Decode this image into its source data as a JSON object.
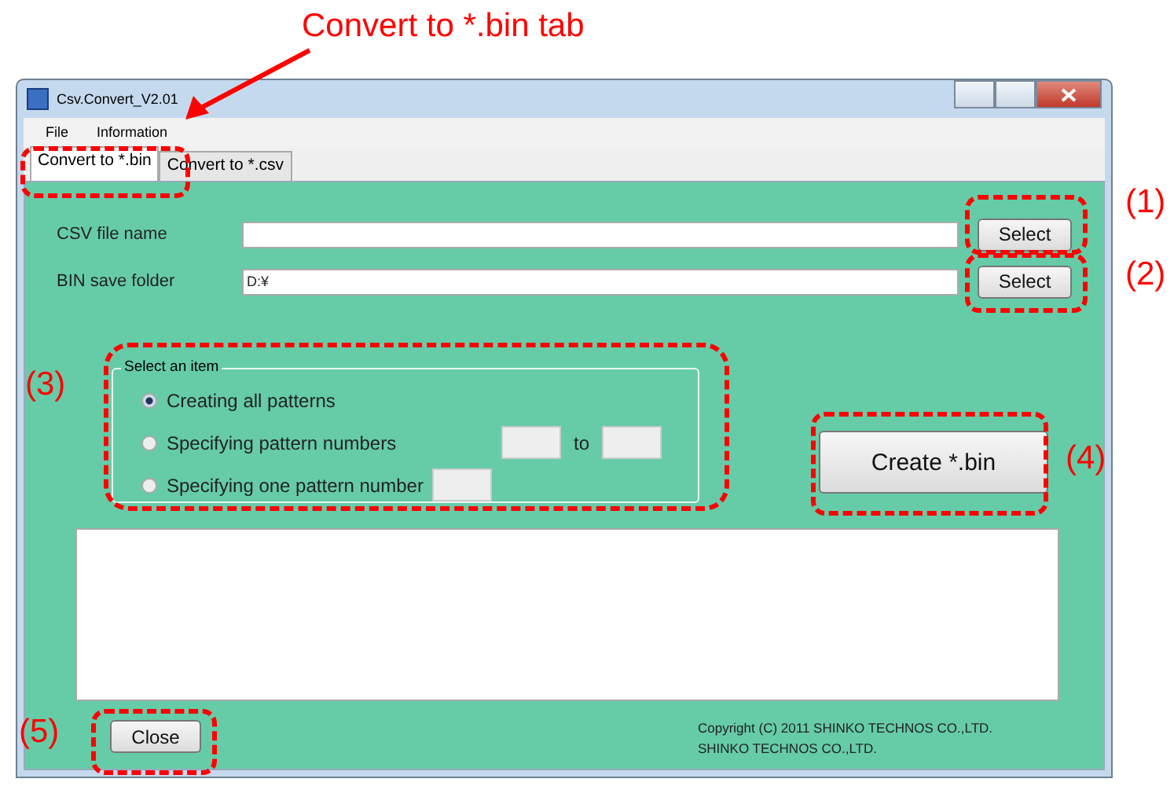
{
  "annotations": {
    "title": "Convert to *.bin tab",
    "markers": [
      {
        "text": "(1)",
        "kind": "select1"
      },
      {
        "text": "(2)",
        "kind": "select2"
      },
      {
        "text": "(3)",
        "kind": "group"
      },
      {
        "text": "(4)",
        "kind": "create"
      },
      {
        "text": "(5)",
        "kind": "close"
      }
    ]
  },
  "window": {
    "title": "Csv.Convert_V2.01"
  },
  "menu": [
    "File",
    "Information"
  ],
  "tabs": [
    {
      "label": "Convert to *.bin",
      "selected": true
    },
    {
      "label": "Convert to *.csv",
      "selected": false
    }
  ],
  "fields": [
    {
      "label": "CSV file name",
      "button": "Select"
    },
    {
      "label": "BIN save folder",
      "value": "D:¥",
      "button": "Select"
    }
  ],
  "group": {
    "title": "Select an item",
    "options": [
      {
        "label": "Creating all patterns",
        "selected": true,
        "kind": "plain"
      },
      {
        "label": "Specifying pattern numbers",
        "selected": false,
        "kind": "range",
        "separator": "to"
      },
      {
        "label": "Specifying one pattern number",
        "selected": false,
        "kind": "single"
      }
    ]
  },
  "create_button": "Create *.bin",
  "close_button": "Close",
  "copyright": [
    "Copyright (C) 2011 SHINKO TECHNOS CO.,LTD.",
    "SHINKO TECHNOS CO.,LTD."
  ]
}
